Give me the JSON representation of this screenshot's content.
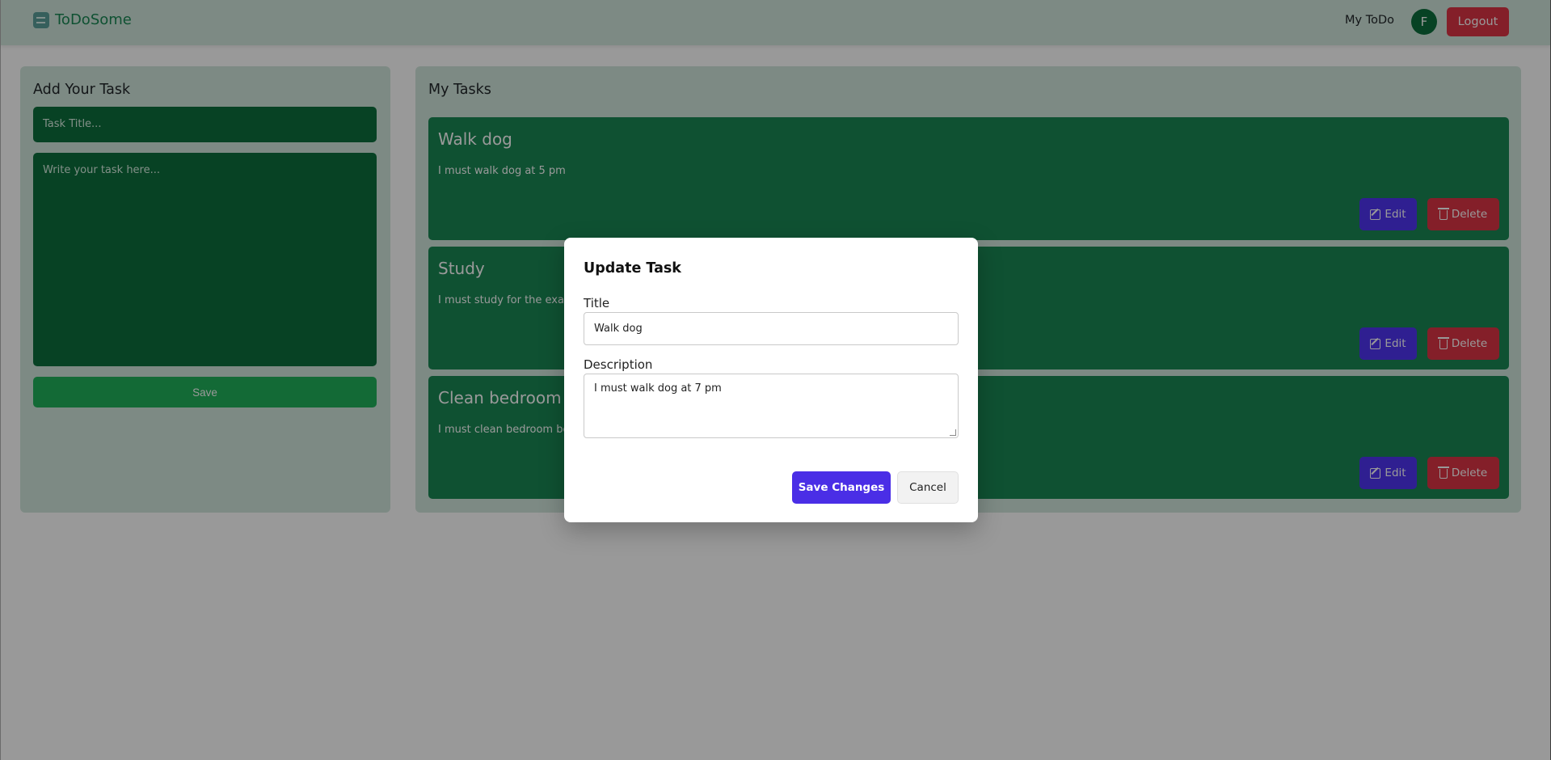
{
  "navbar": {
    "brand": "ToDoSome",
    "my_todo_link": "My ToDo",
    "avatar_initial": "F",
    "logout_label": "Logout"
  },
  "add_task": {
    "heading": "Add Your Task",
    "title_placeholder": "Task Title...",
    "description_placeholder": "Write your task here...",
    "save_label": "Save"
  },
  "my_tasks": {
    "heading": "My Tasks",
    "tasks": [
      {
        "title": "Walk dog",
        "description": "I must walk dog at 5 pm",
        "edit_label": "Edit",
        "delete_label": "Delete"
      },
      {
        "title": "Study",
        "description": "I must study for the exam",
        "edit_label": "Edit",
        "delete_label": "Delete"
      },
      {
        "title": "Clean bedroom",
        "description": "I must clean bedroom before",
        "edit_label": "Edit",
        "delete_label": "Delete"
      }
    ]
  },
  "modal": {
    "title": "Update Task",
    "title_label": "Title",
    "title_value": "Walk dog",
    "description_label": "Description",
    "description_value": "I must walk dog at 7 pm",
    "save_changes_label": "Save Changes",
    "cancel_label": "Cancel"
  },
  "colors": {
    "brand_green": "#198754",
    "panel_bg": "#d1e7dd",
    "card_green": "#198754",
    "edit_purple": "#4f35f2",
    "delete_red": "#dc3545",
    "save_changes_purple": "#4a2ee6"
  }
}
